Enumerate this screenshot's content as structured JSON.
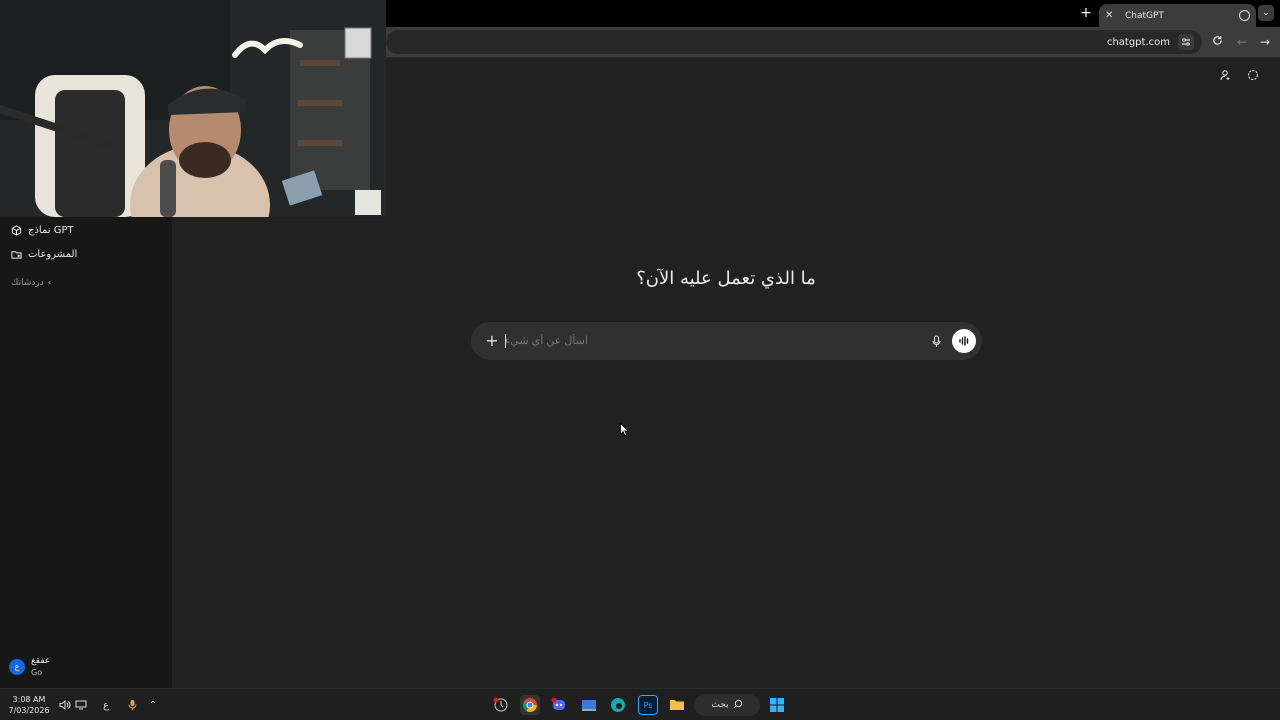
{
  "browser": {
    "tab_title": "ChatGPT",
    "url": "chatgpt.com",
    "new_tab_glyph": "+",
    "tab_menu_glyph": "⌄"
  },
  "sidebar": {
    "items": [
      {
        "label": "نماذج GPT",
        "icon": "cube-icon"
      },
      {
        "label": "المشروعات",
        "icon": "folder-plus-icon"
      }
    ],
    "section_label": "دردشاتك",
    "user": {
      "name": "عفقغ",
      "plan": "Go",
      "avatar_letter": "ع"
    }
  },
  "main": {
    "headline": "ما الذي تعمل عليه الآن؟",
    "composer": {
      "placeholder": "اسأل عن أي شيء"
    }
  },
  "taskbar": {
    "time": "3:08 AM",
    "date": "7/03/2026",
    "language": "ع",
    "search_label": "بحث",
    "apps": [
      "timer-app-icon",
      "chrome-icon",
      "discord-icon",
      "desktop-app-icon",
      "edge-icon",
      "photoshop-icon",
      "file-explorer-icon"
    ]
  },
  "colors": {
    "page_bg": "#212121",
    "sidebar_bg": "#171717",
    "composer_bg": "#303030",
    "accent_avatar": "#1668dc"
  }
}
